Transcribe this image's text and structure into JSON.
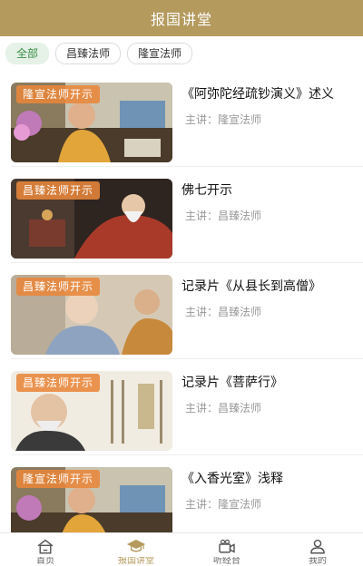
{
  "header": {
    "title": "报国讲堂"
  },
  "filters": [
    "全部",
    "昌臻法师",
    "隆宣法师"
  ],
  "speaker_prefix": "主讲：",
  "items": [
    {
      "badge": "隆宣法师开示",
      "title": "《阿弥陀经疏钞演义》述义",
      "speaker": "隆宣法师"
    },
    {
      "badge": "昌臻法师开示",
      "title": "佛七开示",
      "speaker": "昌臻法师"
    },
    {
      "badge": "昌臻法师开示",
      "title": "记录片《从县长到高僧》",
      "speaker": "昌臻法师"
    },
    {
      "badge": "昌臻法师开示",
      "title": "记录片《菩萨行》",
      "speaker": "昌臻法师"
    },
    {
      "badge": "隆宣法师开示",
      "title": "《入香光室》浅释",
      "speaker": "隆宣法师"
    }
  ],
  "tabbar": [
    {
      "label": "首页",
      "icon": "home-icon"
    },
    {
      "label": "报国讲堂",
      "icon": "graduation-cap-icon"
    },
    {
      "label": "听经台",
      "icon": "video-camera-icon"
    },
    {
      "label": "我的",
      "icon": "user-icon"
    }
  ],
  "colors": {
    "header_bg": "#b49a5d",
    "active_chip_bg": "#e6f2e7",
    "active_chip_text": "#3a8f48",
    "badge_bg": "#e8863a",
    "active_tab": "#b49a5d"
  }
}
